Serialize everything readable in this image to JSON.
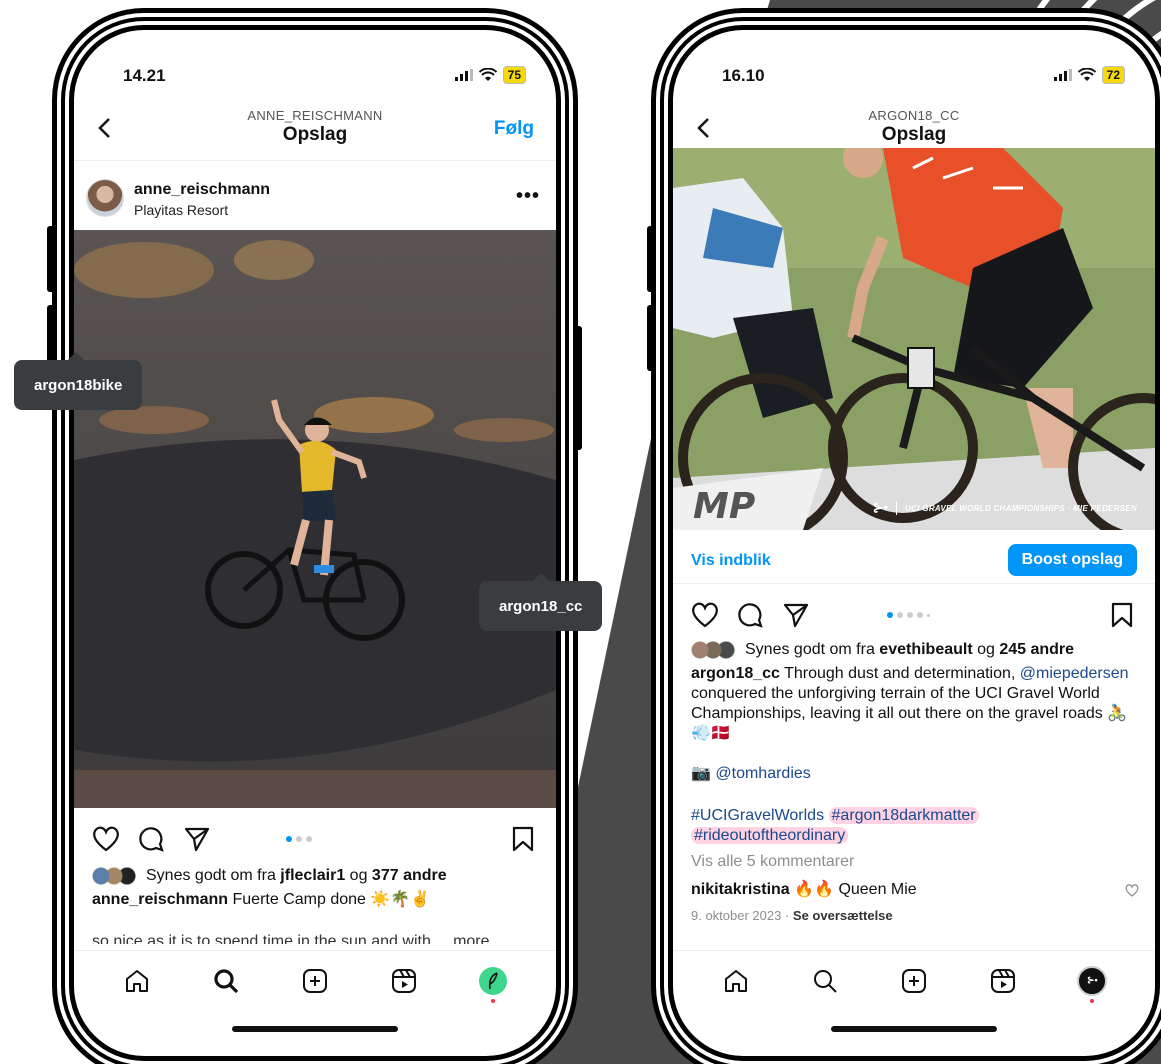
{
  "tooltips": {
    "left": "argon18bike",
    "right": "argon18_cc"
  },
  "phone1": {
    "time": "14.21",
    "battery": "75",
    "nav_user": "ANNE_REISCHMANN",
    "nav_title": "Opslag",
    "follow": "Følg",
    "post_user": "anne_reischmann",
    "post_location": "Playitas Resort",
    "likes_prefix": "Synes godt om fra ",
    "likes_user": "jfleclair1",
    "likes_and": " og ",
    "likes_others": "377 andre",
    "caption_user": "anne_reischmann",
    "caption_text": " Fuerte Camp done ☀️🌴✌️",
    "caption_cut": "so nice as it is to spend time in the sun and with ... more"
  },
  "phone2": {
    "time": "16.10",
    "battery": "72",
    "nav_user": "ARGON18_CC",
    "nav_title": "Opslag",
    "photo_caption": "UCI GRAVEL WORLD CHAMPIONSHIPS · MIE PEDERSEN",
    "insights": "Vis indblik",
    "boost": "Boost opslag",
    "likes_prefix": "Synes godt om fra ",
    "likes_user": "evethibeault",
    "likes_and": " og ",
    "likes_others": "245 andre",
    "caption_user": "argon18_cc",
    "caption_text1": " Through dust and determination, ",
    "caption_mention": "@miepedersen",
    "caption_text2": " conquered the unforgiving terrain of the UCI Gravel World Championships, leaving it all out there on the gravel roads 🚴💨🇩🇰",
    "camera": "📷",
    "photo_credit": "@tomhardies",
    "tag1": "#UCIGravelWorlds",
    "tag2": "#argon18darkmatter",
    "tag3": "#rideoutoftheordinary",
    "view_comments": "Vis alle 5 kommentarer",
    "comment_user": "nikitakristina",
    "comment_text": " 🔥🔥 Queen Mie",
    "comment_date": "9. oktober 2023",
    "comment_sep": " · ",
    "translate": "Se oversættelse"
  }
}
